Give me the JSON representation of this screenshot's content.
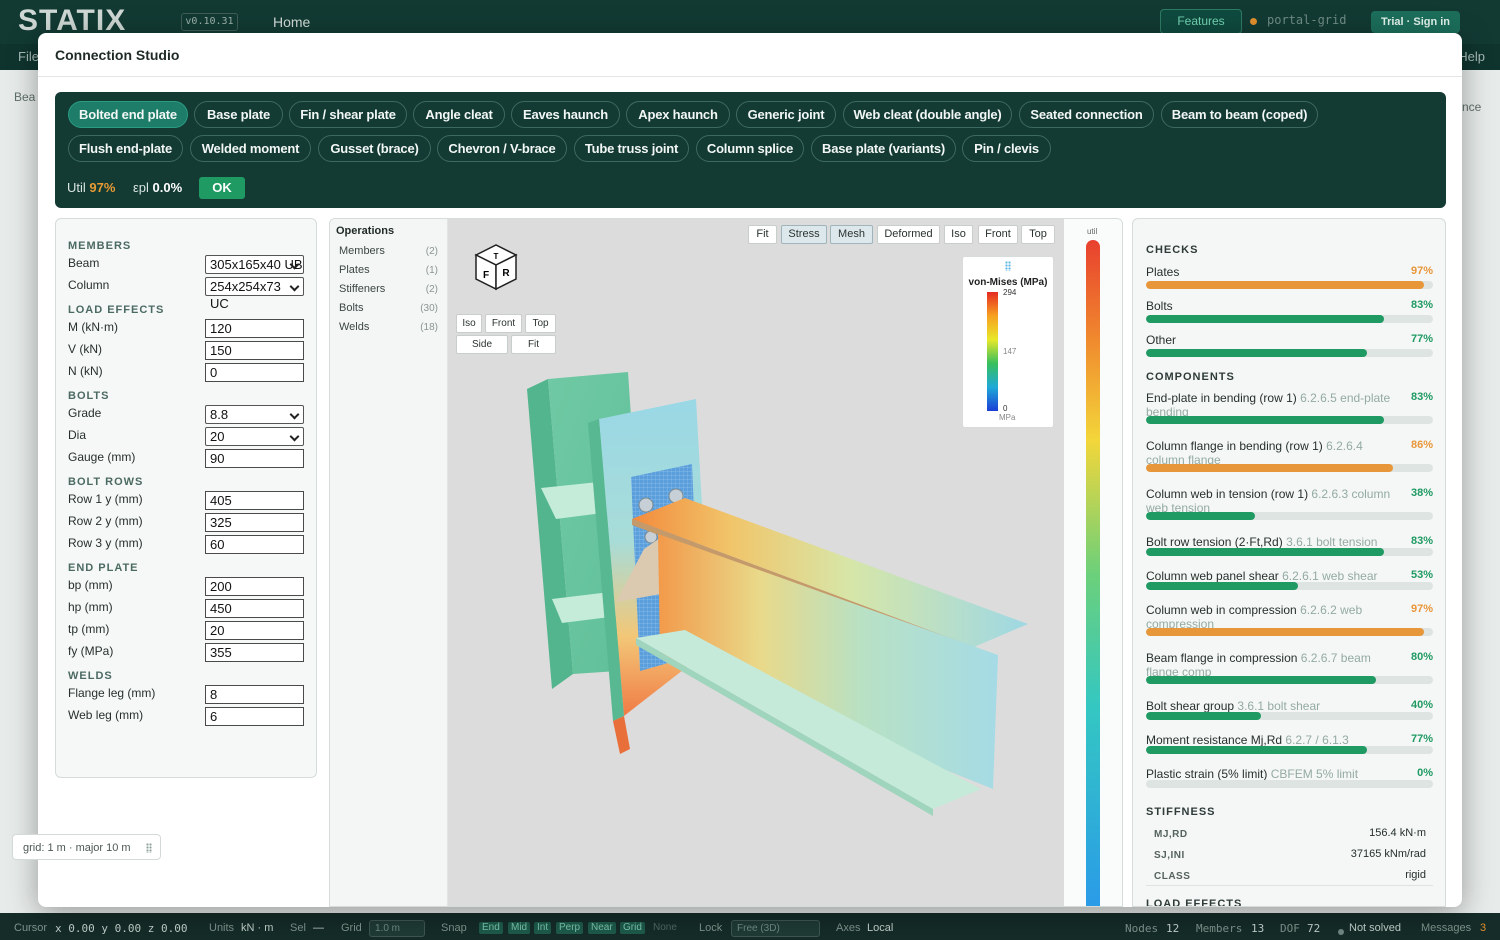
{
  "app": {
    "logo": "STATIX",
    "version": "v0.10.31",
    "home": "Home",
    "features": "Features",
    "portal": "portal-grid",
    "trial": "Trial · Sign in",
    "menu_file": "File",
    "menu_help": "Help",
    "side_left": "Bea",
    "side_right": "nce"
  },
  "grid_chip": "grid: 1 m · major 10 m",
  "statusbar": {
    "cursor_label": "Cursor",
    "cursor": "x 0.00  y 0.00  z 0.00",
    "units_label": "Units",
    "units": "kN · m",
    "sel_label": "Sel",
    "sel": "—",
    "grid_label": "Grid",
    "grid": "1.0 m",
    "snap_label": "Snap",
    "snaps": [
      "End",
      "Mid",
      "Int",
      "Perp",
      "Near",
      "Grid"
    ],
    "snap_none": "None",
    "lock_label": "Lock",
    "lock": "Free (3D)",
    "axes_label": "Axes",
    "axes": "Local",
    "nodes_label": "Nodes",
    "nodes": "12",
    "members_label": "Members",
    "members": "13",
    "dof_label": "DOF",
    "dof": "72",
    "solve_state": "Not solved",
    "messages_label": "Messages",
    "messages": "3"
  },
  "modal": {
    "title": "Connection Studio"
  },
  "connection_types": [
    "Bolted end plate",
    "Base plate",
    "Fin / shear plate",
    "Angle cleat",
    "Eaves haunch",
    "Apex haunch",
    "Generic joint",
    "Web cleat (double angle)",
    "Seated connection",
    "Beam to beam (coped)",
    "Flush end-plate",
    "Welded moment",
    "Gusset (brace)",
    "Chevron / V-brace",
    "Tube truss joint",
    "Column splice",
    "Base plate (variants)",
    "Pin / clevis"
  ],
  "active_type": "Bolted end plate",
  "summary": {
    "util_label": "Util",
    "util": "97%",
    "epl_label": "εpl",
    "epl": "0.0%",
    "status": "OK"
  },
  "params": {
    "members_title": "MEMBERS",
    "beam_label": "Beam",
    "beam": "305x165x40 UB",
    "column_label": "Column",
    "column": "254x254x73 UC",
    "loads_title": "LOAD EFFECTS",
    "m_label": "M (kN·m)",
    "m": "120",
    "v_label": "V (kN)",
    "v": "150",
    "n_label": "N (kN)",
    "n": "0",
    "bolts_title": "BOLTS",
    "grade_label": "Grade",
    "grade": "8.8",
    "dia_label": "Dia",
    "dia": "20",
    "gauge_label": "Gauge (mm)",
    "gauge": "90",
    "rows_title": "BOLT ROWS",
    "row1_label": "Row 1 y (mm)",
    "row1": "405",
    "row2_label": "Row 2 y (mm)",
    "row2": "325",
    "row3_label": "Row 3 y (mm)",
    "row3": "60",
    "plate_title": "END PLATE",
    "bp_label": "bp (mm)",
    "bp": "200",
    "hp_label": "hp (mm)",
    "hp": "450",
    "tp_label": "tp (mm)",
    "tp": "20",
    "fy_label": "fy (MPa)",
    "fy": "355",
    "welds_title": "WELDS",
    "flange_label": "Flange leg (mm)",
    "flange": "8",
    "web_label": "Web leg (mm)",
    "web": "6"
  },
  "operations": {
    "title": "Operations",
    "items": [
      {
        "label": "Members",
        "count": "(2)"
      },
      {
        "label": "Plates",
        "count": "(1)"
      },
      {
        "label": "Stiffeners",
        "count": "(2)"
      },
      {
        "label": "Bolts",
        "count": "(30)"
      },
      {
        "label": "Welds",
        "count": "(18)"
      }
    ]
  },
  "viewport": {
    "toolbar": [
      "Fit",
      "Stress",
      "Mesh",
      "Deformed",
      "Iso",
      "Front",
      "Top"
    ],
    "cube": [
      "T",
      "F",
      "R"
    ],
    "views": [
      "Iso",
      "Front",
      "Top",
      "Side",
      "Fit"
    ],
    "legend": {
      "title": "von-Mises (MPa)",
      "max": "294",
      "mid": "147",
      "min": "0",
      "unit": "MPa"
    },
    "util_label": "util"
  },
  "checks": {
    "title": "CHECKS",
    "summary": [
      {
        "name": "Plates",
        "pct": "97%",
        "value": 0.97,
        "color": "#e8963a"
      },
      {
        "name": "Bolts",
        "pct": "83%",
        "value": 0.83,
        "color": "#1f9a63"
      },
      {
        "name": "Other",
        "pct": "77%",
        "value": 0.77,
        "color": "#1f9a63"
      }
    ],
    "components_title": "COMPONENTS",
    "components": [
      {
        "name": "End-plate in bending (row 1)",
        "ref": "6.2.6.5 end-plate bending",
        "pct": "83%",
        "value": 0.83,
        "color": "#1f9a63"
      },
      {
        "name": "Column flange in bending (row 1)",
        "ref": "6.2.6.4 column flange",
        "pct": "86%",
        "value": 0.86,
        "color": "#e8963a"
      },
      {
        "name": "Column web in tension (row 1)",
        "ref": "6.2.6.3 column web tension",
        "pct": "38%",
        "value": 0.38,
        "color": "#1f9a63"
      },
      {
        "name": "Bolt row tension (2·Ft,Rd)",
        "ref": "3.6.1 bolt tension",
        "pct": "83%",
        "value": 0.83,
        "color": "#1f9a63"
      },
      {
        "name": "Column web panel shear",
        "ref": "6.2.6.1 web shear",
        "pct": "53%",
        "value": 0.53,
        "color": "#1f9a63"
      },
      {
        "name": "Column web in compression",
        "ref": "6.2.6.2 web compression",
        "pct": "97%",
        "value": 0.97,
        "color": "#e8963a"
      },
      {
        "name": "Beam flange in compression",
        "ref": "6.2.6.7 beam flange comp",
        "pct": "80%",
        "value": 0.8,
        "color": "#1f9a63"
      },
      {
        "name": "Bolt shear group",
        "ref": "3.6.1 bolt shear",
        "pct": "40%",
        "value": 0.4,
        "color": "#1f9a63"
      },
      {
        "name": "Moment resistance Mj,Rd",
        "ref": "6.2.7 / 6.1.3",
        "pct": "77%",
        "value": 0.77,
        "color": "#1f9a63"
      },
      {
        "name": "Plastic strain (5% limit)",
        "ref": "CBFEM 5% limit",
        "pct": "0%",
        "value": 0.0,
        "color": "#1f9a63"
      }
    ],
    "stiffness_title": "STIFFNESS",
    "stiffness": [
      {
        "label": "MJ,RD",
        "value": "156.4 kN·m"
      },
      {
        "label": "SJ,INI",
        "value": "37165 kNm/rad"
      },
      {
        "label": "CLASS",
        "value": "rigid"
      }
    ],
    "load_effects_title": "LOAD EFFECTS"
  },
  "colors": {
    "accent": "#1e7d68",
    "warn": "#e8963a",
    "ok": "#1f9a63",
    "bar_dark": "#133a33"
  }
}
